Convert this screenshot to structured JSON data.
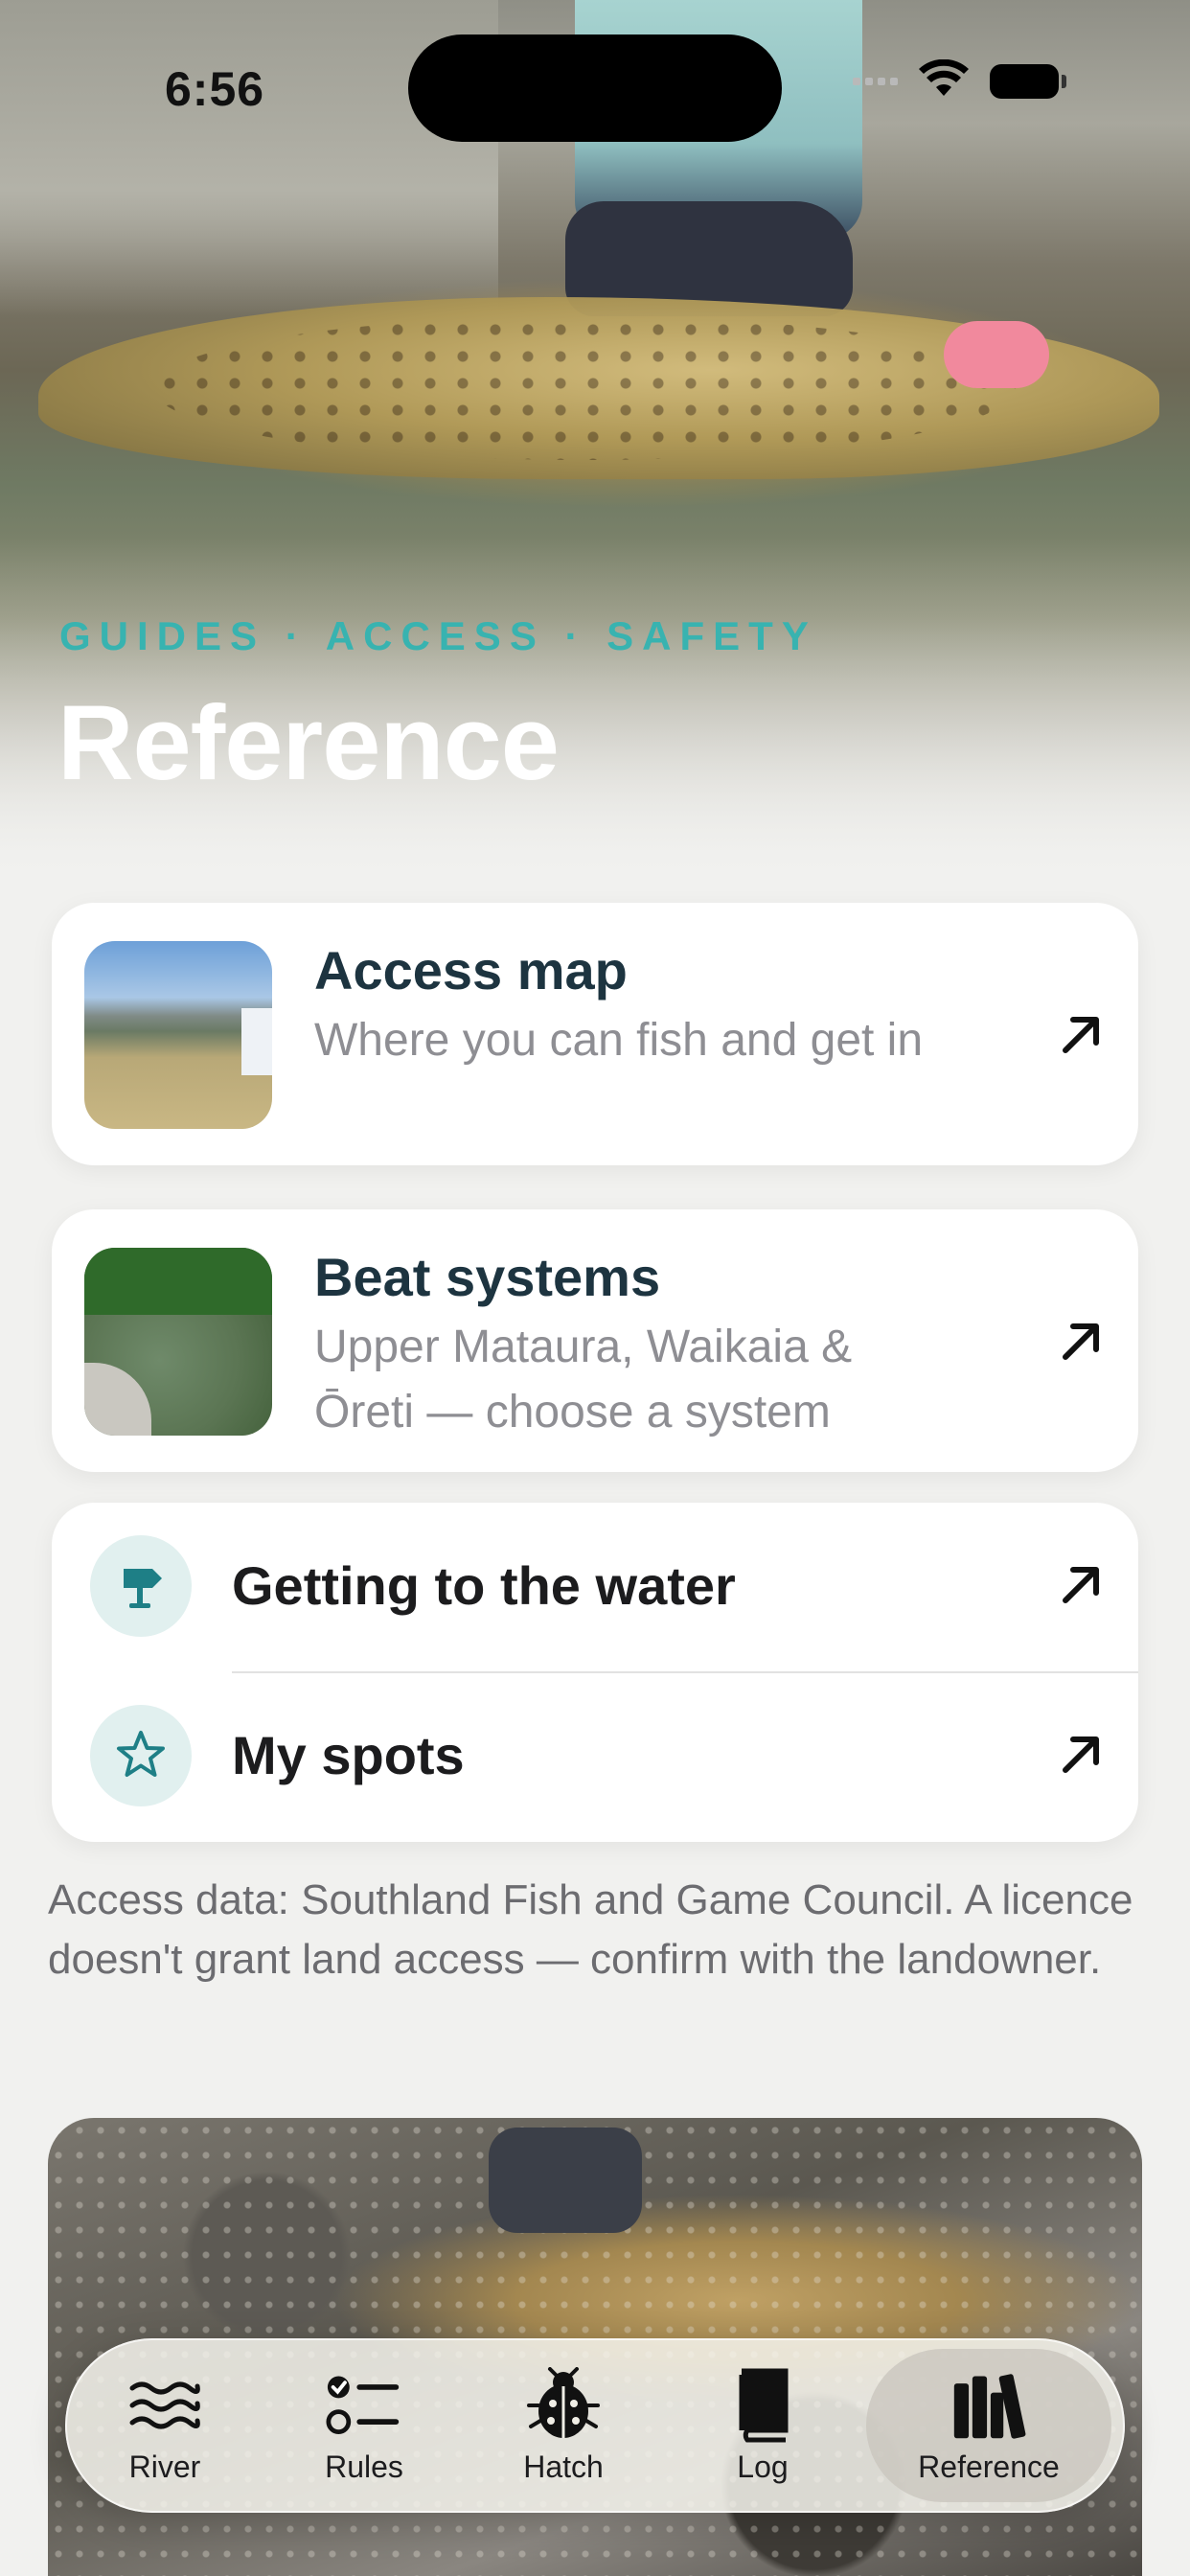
{
  "status_bar": {
    "time": "6:56"
  },
  "hero": {
    "eyebrow": "GUIDES · ACCESS · SAFETY",
    "title": "Reference"
  },
  "feature_cards": [
    {
      "title": "Access map",
      "subtitle": "Where you can fish and get in",
      "thumbnail": "access-map-photo",
      "action_icon": "arrow-up-right-icon"
    },
    {
      "title": "Beat systems",
      "subtitle": "Upper Mataura, Waikaia & Ōreti — choose a system",
      "thumbnail": "river-photo",
      "action_icon": "arrow-up-right-icon"
    }
  ],
  "list_rows": [
    {
      "label": "Getting to the water",
      "icon": "signpost-icon",
      "action_icon": "arrow-up-right-icon"
    },
    {
      "label": "My spots",
      "icon": "star-icon",
      "action_icon": "arrow-up-right-icon"
    }
  ],
  "note": "Access data: Southland Fish and Game Council. A licence doesn't grant land access — confirm with the landowner.",
  "tab_bar": {
    "active": "Reference",
    "items": [
      {
        "label": "River",
        "icon": "waves-icon"
      },
      {
        "label": "Rules",
        "icon": "checklist-icon"
      },
      {
        "label": "Hatch",
        "icon": "ladybug-icon"
      },
      {
        "label": "Log",
        "icon": "book-icon"
      },
      {
        "label": "Reference",
        "icon": "books-icon"
      }
    ]
  },
  "colors": {
    "accent": "#38b3b0",
    "icon_teal": "#1e7f86",
    "icon_bg": "#e1f0ef",
    "title": "#1d3440"
  }
}
